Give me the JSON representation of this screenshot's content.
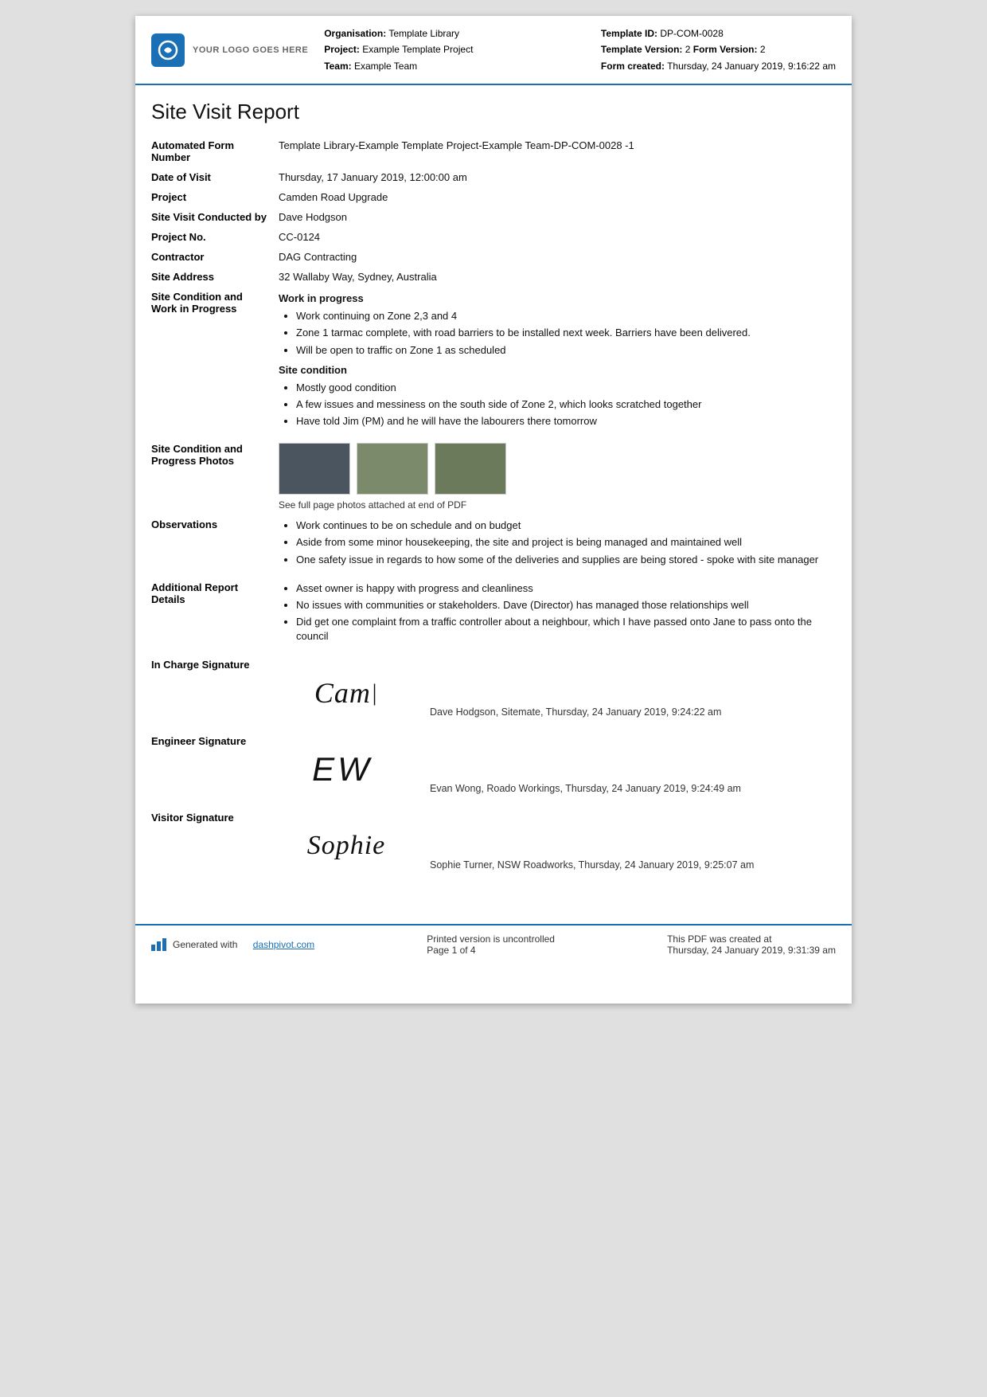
{
  "header": {
    "logo_text": "YOUR LOGO GOES HERE",
    "org_label": "Organisation:",
    "org_value": "Template Library",
    "project_label": "Project:",
    "project_value": "Example Template Project",
    "team_label": "Team:",
    "team_value": "Example Team",
    "template_id_label": "Template ID:",
    "template_id_value": "DP-COM-0028",
    "template_version_label": "Template Version:",
    "template_version_value": "2",
    "form_version_label": "Form Version:",
    "form_version_value": "2",
    "form_created_label": "Form created:",
    "form_created_value": "Thursday, 24 January 2019, 9:16:22 am"
  },
  "report": {
    "title": "Site Visit Report",
    "fields": {
      "automated_form_number_label": "Automated Form Number",
      "automated_form_number_value": "Template Library-Example Template Project-Example Team-DP-COM-0028   -1",
      "date_of_visit_label": "Date of Visit",
      "date_of_visit_value": "Thursday, 17 January 2019, 12:00:00 am",
      "project_label": "Project",
      "project_value": "Camden Road Upgrade",
      "site_visit_conducted_label": "Site Visit Conducted by",
      "site_visit_conducted_value": "Dave Hodgson",
      "project_no_label": "Project No.",
      "project_no_value": "CC-0124",
      "contractor_label": "Contractor",
      "contractor_value": "DAG Contracting",
      "site_address_label": "Site Address",
      "site_address_value": "32 Wallaby Way, Sydney, Australia",
      "site_condition_label": "Site Condition and Work in Progress",
      "site_condition_heading1": "Work in progress",
      "site_condition_bullets1": [
        "Work continuing on Zone 2,3 and 4",
        "Zone 1 tarmac complete, with road barriers to be installed next week. Barriers have been delivered.",
        "Will be open to traffic on Zone 1 as scheduled"
      ],
      "site_condition_heading2": "Site condition",
      "site_condition_bullets2": [
        "Mostly good condition",
        "A few issues and messiness on the south side of Zone 2, which looks scratched together",
        "Have told Jim (PM) and he will have the labourers there tomorrow"
      ],
      "photos_label": "Site Condition and Progress Photos",
      "photos_caption": "See full page photos attached at end of PDF",
      "observations_label": "Observations",
      "observations_bullets": [
        "Work continues to be on schedule and on budget",
        "Aside from some minor housekeeping, the site and project is being managed and maintained well",
        "One safety issue in regards to how some of the deliveries and supplies are being stored - spoke with site manager"
      ],
      "additional_label": "Additional Report Details",
      "additional_bullets": [
        "Asset owner is happy with progress and cleanliness",
        "No issues with communities or stakeholders. Dave (Director) has managed those relationships well",
        "Did get one complaint from a traffic controller about a neighbour, which I have passed onto Jane to pass onto the council"
      ]
    },
    "signatures": {
      "in_charge_label": "In Charge Signature",
      "in_charge_sig": "Cam",
      "in_charge_text": "Dave Hodgson, Sitemate, Thursday, 24 January 2019, 9:24:22 am",
      "engineer_label": "Engineer Signature",
      "engineer_sig": "EW",
      "engineer_text": "Evan Wong, Roado Workings, Thursday, 24 January 2019, 9:24:49 am",
      "visitor_label": "Visitor Signature",
      "visitor_sig": "Sophie",
      "visitor_text": "Sophie Turner, NSW Roadworks, Thursday, 24 January 2019, 9:25:07 am"
    }
  },
  "footer": {
    "generated_text": "Generated with",
    "link_text": "dashpivot.com",
    "uncontrolled_text": "Printed version is uncontrolled",
    "page_text": "Page 1 of 4",
    "created_label": "This PDF was created at",
    "created_value": "Thursday, 24 January 2019, 9:31:39 am"
  }
}
